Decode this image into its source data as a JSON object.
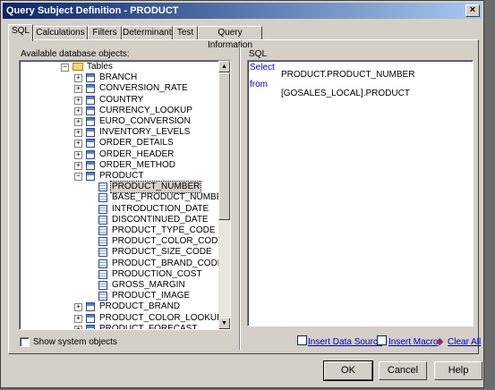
{
  "window": {
    "title": "Query Subject Definition - PRODUCT"
  },
  "tabs": [
    "SQL",
    "Calculations",
    "Filters",
    "Determinants",
    "Test",
    "Query Information"
  ],
  "left_panel": {
    "label": "Available database objects:"
  },
  "tree": {
    "root": "Tables",
    "tables_before": [
      "BRANCH",
      "CONVERSION_RATE",
      "COUNTRY",
      "CURRENCY_LOOKUP",
      "EURO_CONVERSION",
      "INVENTORY_LEVELS",
      "ORDER_DETAILS",
      "ORDER_HEADER",
      "ORDER_METHOD"
    ],
    "expanded_table": "PRODUCT",
    "columns": [
      "PRODUCT_NUMBER",
      "BASE_PRODUCT_NUMBER",
      "INTRODUCTION_DATE",
      "DISCONTINUED_DATE",
      "PRODUCT_TYPE_CODE",
      "PRODUCT_COLOR_CODE",
      "PRODUCT_SIZE_CODE",
      "PRODUCT_BRAND_CODE",
      "PRODUCTION_COST",
      "GROSS_MARGIN",
      "PRODUCT_IMAGE"
    ],
    "selected_column": "PRODUCT_NUMBER",
    "tables_after": [
      "PRODUCT_BRAND",
      "PRODUCT_COLOR_LOOKUP",
      "PRODUCT_FORECAST"
    ]
  },
  "sql_panel": {
    "label": "SQL",
    "select_kw": "Select",
    "select_value": "PRODUCT.PRODUCT_NUMBER",
    "from_kw": "from",
    "from_value": "[GOSALES_LOCAL].PRODUCT"
  },
  "show_system_objects": {
    "label": "Show system objects",
    "checked": false
  },
  "links": {
    "insert_data_source": "Insert Data Source",
    "insert_macro": "Insert Macro",
    "clear_all": "Clear All"
  },
  "buttons": {
    "ok": "OK",
    "cancel": "Cancel",
    "help": "Help"
  },
  "colors": {
    "link": "#0000c0",
    "sql_keyword": "#0000c0",
    "selected_bg": "#d4d0c8",
    "titlebar": "#0a246a"
  }
}
